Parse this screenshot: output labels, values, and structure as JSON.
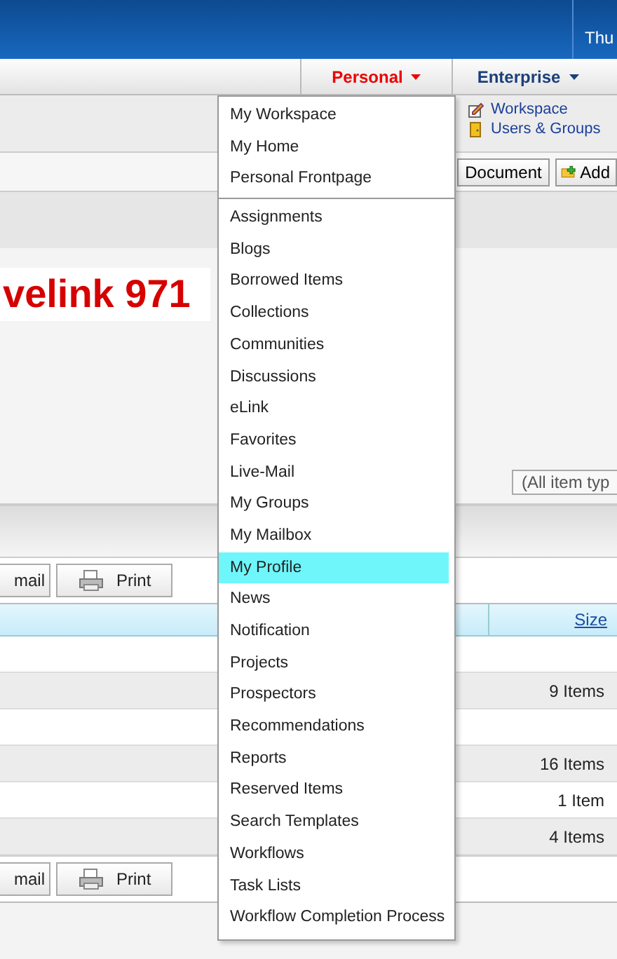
{
  "header": {
    "date": "Thu"
  },
  "nav": {
    "tabs": [
      {
        "label": "Personal",
        "selected": true
      },
      {
        "label": "Enterprise",
        "selected": false
      }
    ]
  },
  "sub_links": [
    {
      "label": "Workspace",
      "kind": "workspace"
    },
    {
      "label": "Users & Groups",
      "kind": "users"
    }
  ],
  "toolbar": {
    "buttons": [
      {
        "label": "Document",
        "kind": "plain"
      },
      {
        "label": "Add",
        "kind": "add"
      }
    ]
  },
  "title": "velink 971",
  "filter": {
    "value": "(All item typ"
  },
  "action_buttons_top": [
    {
      "label": "mail",
      "kind": "plain"
    },
    {
      "label": "Print",
      "kind": "print"
    }
  ],
  "table": {
    "columns": [
      {
        "label": "Size"
      }
    ],
    "rows": [
      {},
      {
        "size": "9 Items"
      },
      {},
      {
        "size": "16 Items"
      },
      {
        "size": "1 Item"
      },
      {
        "size": "4 Items"
      }
    ]
  },
  "action_buttons_bottom": [
    {
      "label": "mail",
      "kind": "plain"
    },
    {
      "label": "Print",
      "kind": "print"
    }
  ],
  "personal_menu": {
    "groups": [
      [
        {
          "label": "My Workspace",
          "selected": false
        },
        {
          "label": "My Home",
          "selected": false
        },
        {
          "label": "Personal Frontpage",
          "selected": false
        }
      ],
      [
        {
          "label": "Assignments",
          "selected": false
        },
        {
          "label": "Blogs",
          "selected": false
        },
        {
          "label": "Borrowed Items",
          "selected": false
        },
        {
          "label": "Collections",
          "selected": false
        },
        {
          "label": "Communities",
          "selected": false
        },
        {
          "label": "Discussions",
          "selected": false
        },
        {
          "label": "eLink",
          "selected": false
        },
        {
          "label": "Favorites",
          "selected": false
        },
        {
          "label": "Live-Mail",
          "selected": false
        },
        {
          "label": "My Groups",
          "selected": false
        },
        {
          "label": "My Mailbox",
          "selected": false
        },
        {
          "label": "My Profile",
          "selected": true
        },
        {
          "label": "News",
          "selected": false
        },
        {
          "label": "Notification",
          "selected": false
        },
        {
          "label": "Projects",
          "selected": false
        },
        {
          "label": "Prospectors",
          "selected": false
        },
        {
          "label": "Recommendations",
          "selected": false
        },
        {
          "label": "Reports",
          "selected": false
        },
        {
          "label": "Reserved Items",
          "selected": false
        },
        {
          "label": "Search Templates",
          "selected": false
        },
        {
          "label": "Workflows",
          "selected": false
        },
        {
          "label": "Task Lists",
          "selected": false
        },
        {
          "label": "Workflow Completion Process",
          "selected": false
        }
      ]
    ]
  }
}
